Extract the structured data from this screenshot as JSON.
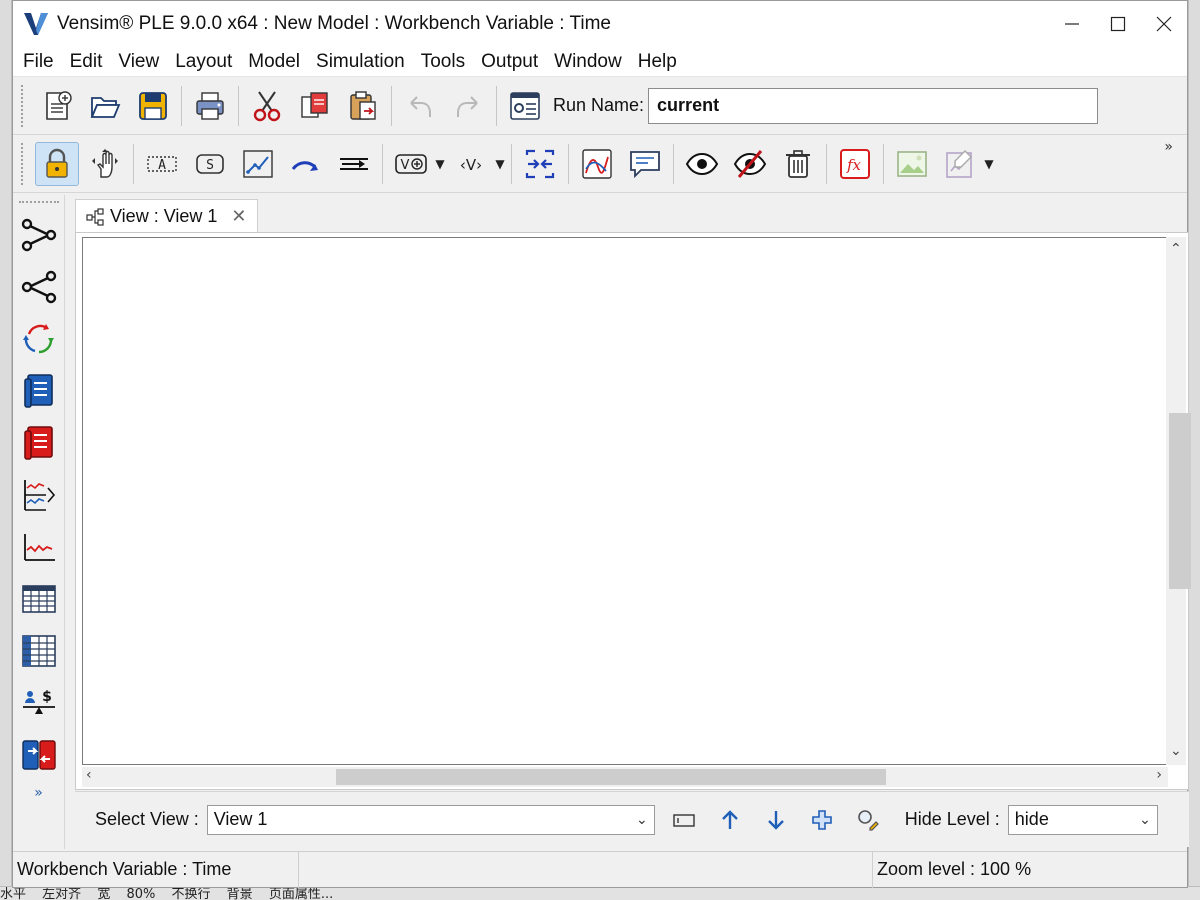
{
  "window": {
    "title": "Vensim® PLE 9.0.0 x64 : New Model : Workbench Variable : Time"
  },
  "menu": [
    "File",
    "Edit",
    "View",
    "Layout",
    "Model",
    "Simulation",
    "Tools",
    "Output",
    "Window",
    "Help"
  ],
  "toolbar": {
    "run_name_label": "Run Name:",
    "run_name_value": "current",
    "overflow": "»"
  },
  "left_toolbar": {
    "more": "»"
  },
  "tab": {
    "label": "View : View 1",
    "close": "✕"
  },
  "view_bar": {
    "select_view_label": "Select View :",
    "select_view_value": "View 1",
    "hide_level_label": "Hide Level :",
    "hide_level_value": "hide"
  },
  "status": {
    "workbench": "Workbench Variable : Time",
    "zoom": "Zoom level : 100 %"
  },
  "background_fragments": {
    "bottom": [
      "水平",
      "左对齐",
      "宽",
      "80%",
      "不换行",
      "背景",
      "页面属性..."
    ]
  },
  "colors": {
    "accent_blue": "#1f5fb8",
    "lock_bg": "#cfe3f7",
    "red_icon": "#d81b1b"
  }
}
